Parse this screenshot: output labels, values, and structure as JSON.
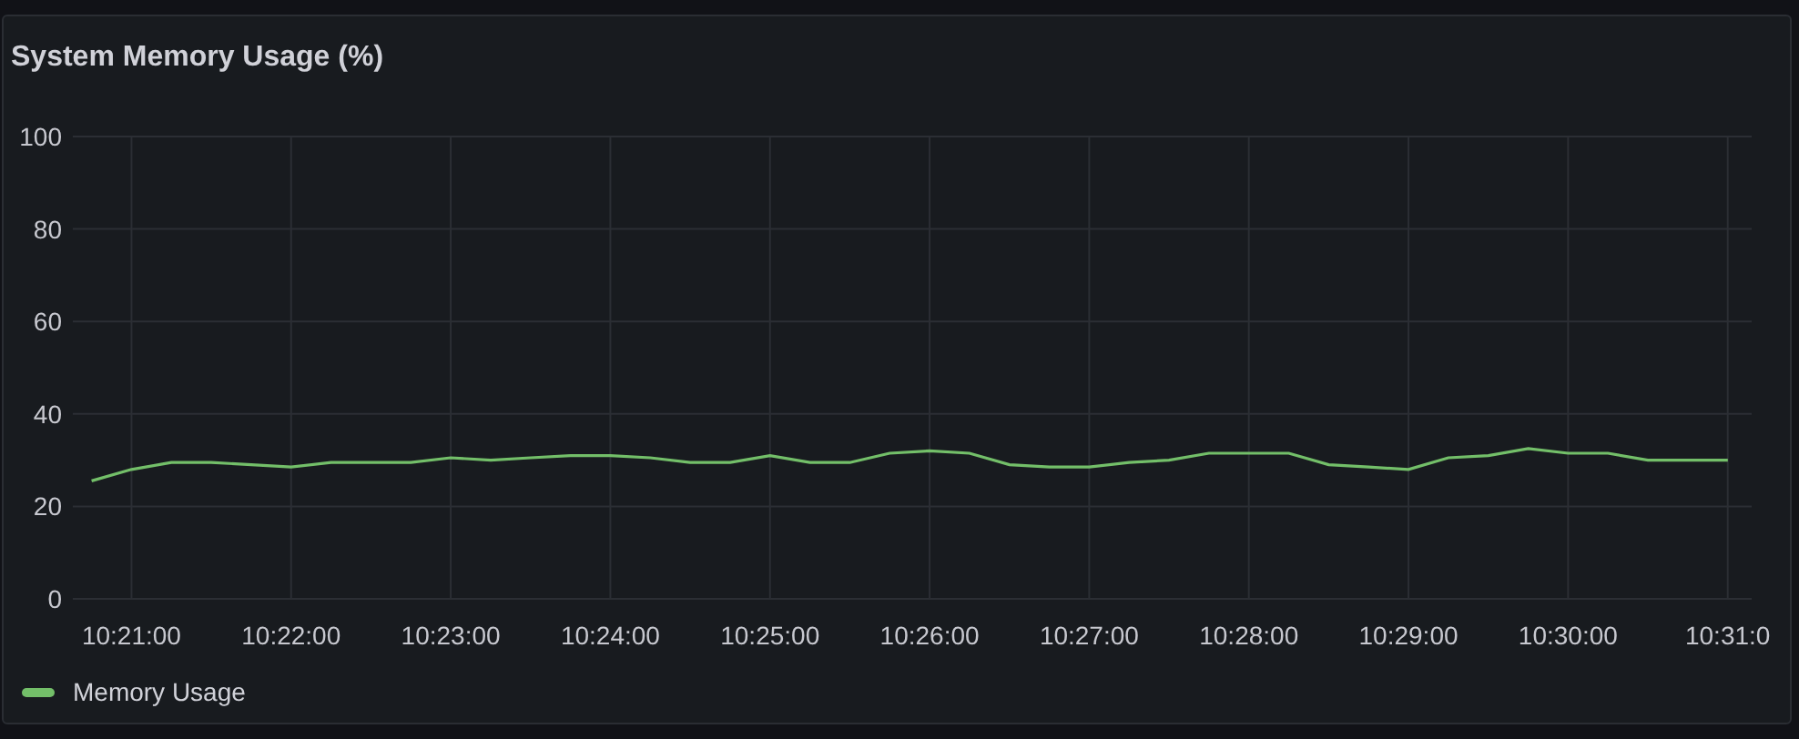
{
  "panel": {
    "title": "System Memory Usage (%)",
    "chart_data": {
      "type": "line",
      "grid": true,
      "ylim": [
        0,
        100
      ],
      "yticks": [
        0,
        20,
        40,
        60,
        80,
        100
      ],
      "categories": [
        null,
        "10:21:00",
        null,
        null,
        null,
        "10:22:00",
        null,
        null,
        null,
        "10:23:00",
        null,
        null,
        null,
        "10:24:00",
        null,
        null,
        null,
        "10:25:00",
        null,
        null,
        null,
        "10:26:00",
        null,
        null,
        null,
        "10:27:00",
        null,
        null,
        null,
        "10:28:00",
        null,
        null,
        null,
        "10:29:00",
        null,
        null,
        null,
        "10:30:00",
        null,
        null,
        null,
        "10:31:0"
      ],
      "series": [
        {
          "name": "Memory Usage",
          "color": "#73bf69",
          "values": [
            25.5,
            28,
            29.5,
            29.5,
            29,
            28.5,
            29.5,
            29.5,
            29.5,
            30.5,
            30,
            30.5,
            31,
            31,
            30.5,
            29.5,
            29.5,
            31,
            29.5,
            29.5,
            31.5,
            32,
            31.5,
            29,
            28.5,
            28.5,
            29.5,
            30,
            31.5,
            31.5,
            31.5,
            29,
            28.5,
            28,
            30.5,
            31,
            32.5,
            31.5,
            31.5,
            30,
            30,
            30
          ]
        }
      ]
    }
  }
}
